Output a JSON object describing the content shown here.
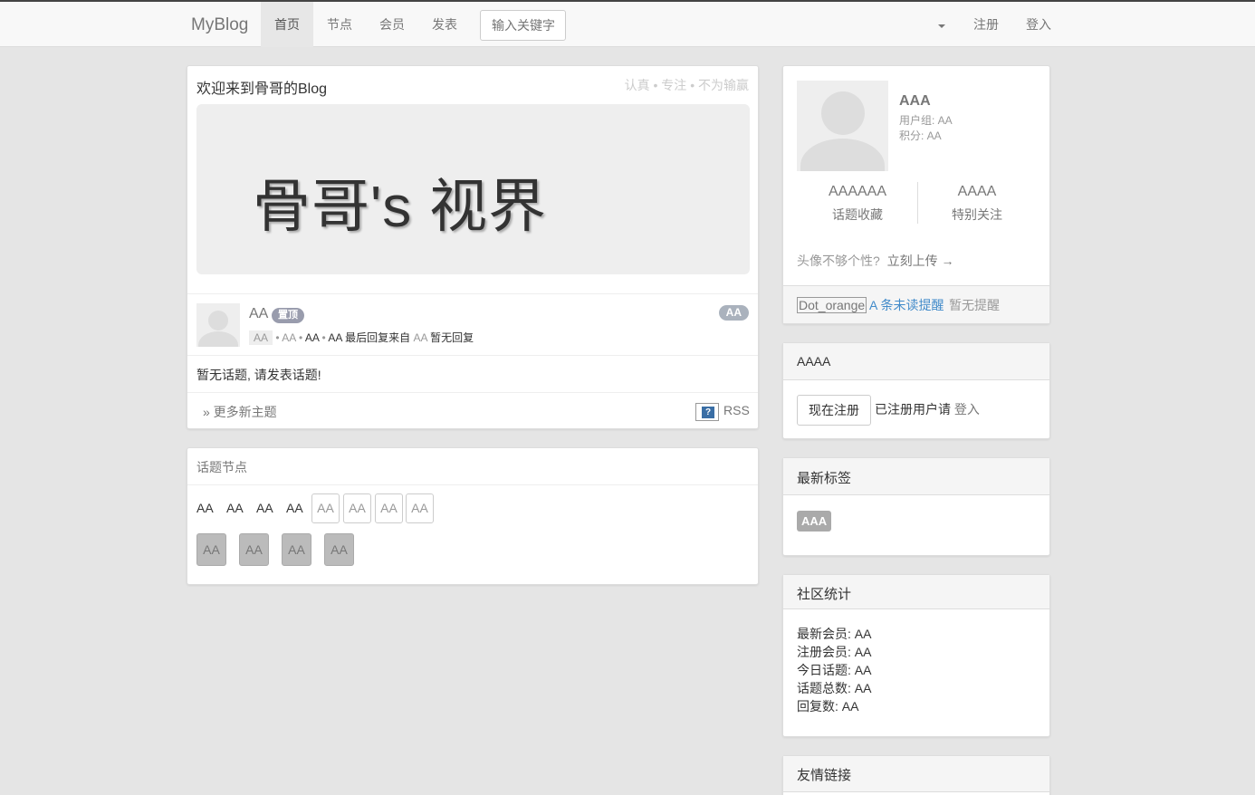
{
  "navbar": {
    "brand": "MyBlog",
    "items": [
      {
        "label": "首页",
        "active": true
      },
      {
        "label": "节点"
      },
      {
        "label": "会员"
      },
      {
        "label": "发表"
      }
    ],
    "search_placeholder": "输入关键字",
    "register": "注册",
    "login": "登入"
  },
  "welcome": {
    "title": "欢迎来到骨哥的Blog",
    "motto": "认真 • 专注 • 不为输赢",
    "hero_text": "骨哥's 视界"
  },
  "topic": {
    "name": "AA",
    "sticky_badge": "置顶",
    "reply_count": "AA",
    "meta": {
      "node": "AA",
      "author": "AA",
      "time": "AA",
      "last_reply_user": "AA",
      "last_reply_text": "最后回复来自",
      "last_reply_from": "AA",
      "no_reply": "暂无回复"
    },
    "empty_message": "暂无话题, 请发表话题!",
    "more_link": "» 更多新主题",
    "rss_label": "RSS"
  },
  "nodes": {
    "title": "话题节点",
    "plain": [
      "AA",
      "AA",
      "AA",
      "AA"
    ],
    "outlined": [
      "AA",
      "AA",
      "AA",
      "AA"
    ],
    "filled": [
      "AA",
      "AA",
      "AA",
      "AA"
    ]
  },
  "user": {
    "name": "AAA",
    "group": "用户组: AA",
    "points": "积分: AA",
    "favorites_count": "AAAAAA",
    "favorites_label": "话题收藏",
    "follow_count": "AAAA",
    "follow_label": "特别关注",
    "upload_hint": "头像不够个性?",
    "upload_link": "立刻上传 →",
    "dot_orange": "Dot_orange",
    "unread": "A 条未读提醒",
    "no_remind": "暂无提醒"
  },
  "register_panel": {
    "title": "AAAA",
    "button": "现在注册",
    "hint": "已注册用户请",
    "login": "登入"
  },
  "tags_panel": {
    "title": "最新标签",
    "tag": "AAA"
  },
  "stats_panel": {
    "title": "社区统计",
    "rows": [
      "最新会员: AA",
      "注册会员:  AA",
      "今日话题: AA",
      "话题总数:  AA",
      "回复数:  AA"
    ]
  },
  "links_panel": {
    "title": "友情链接"
  }
}
